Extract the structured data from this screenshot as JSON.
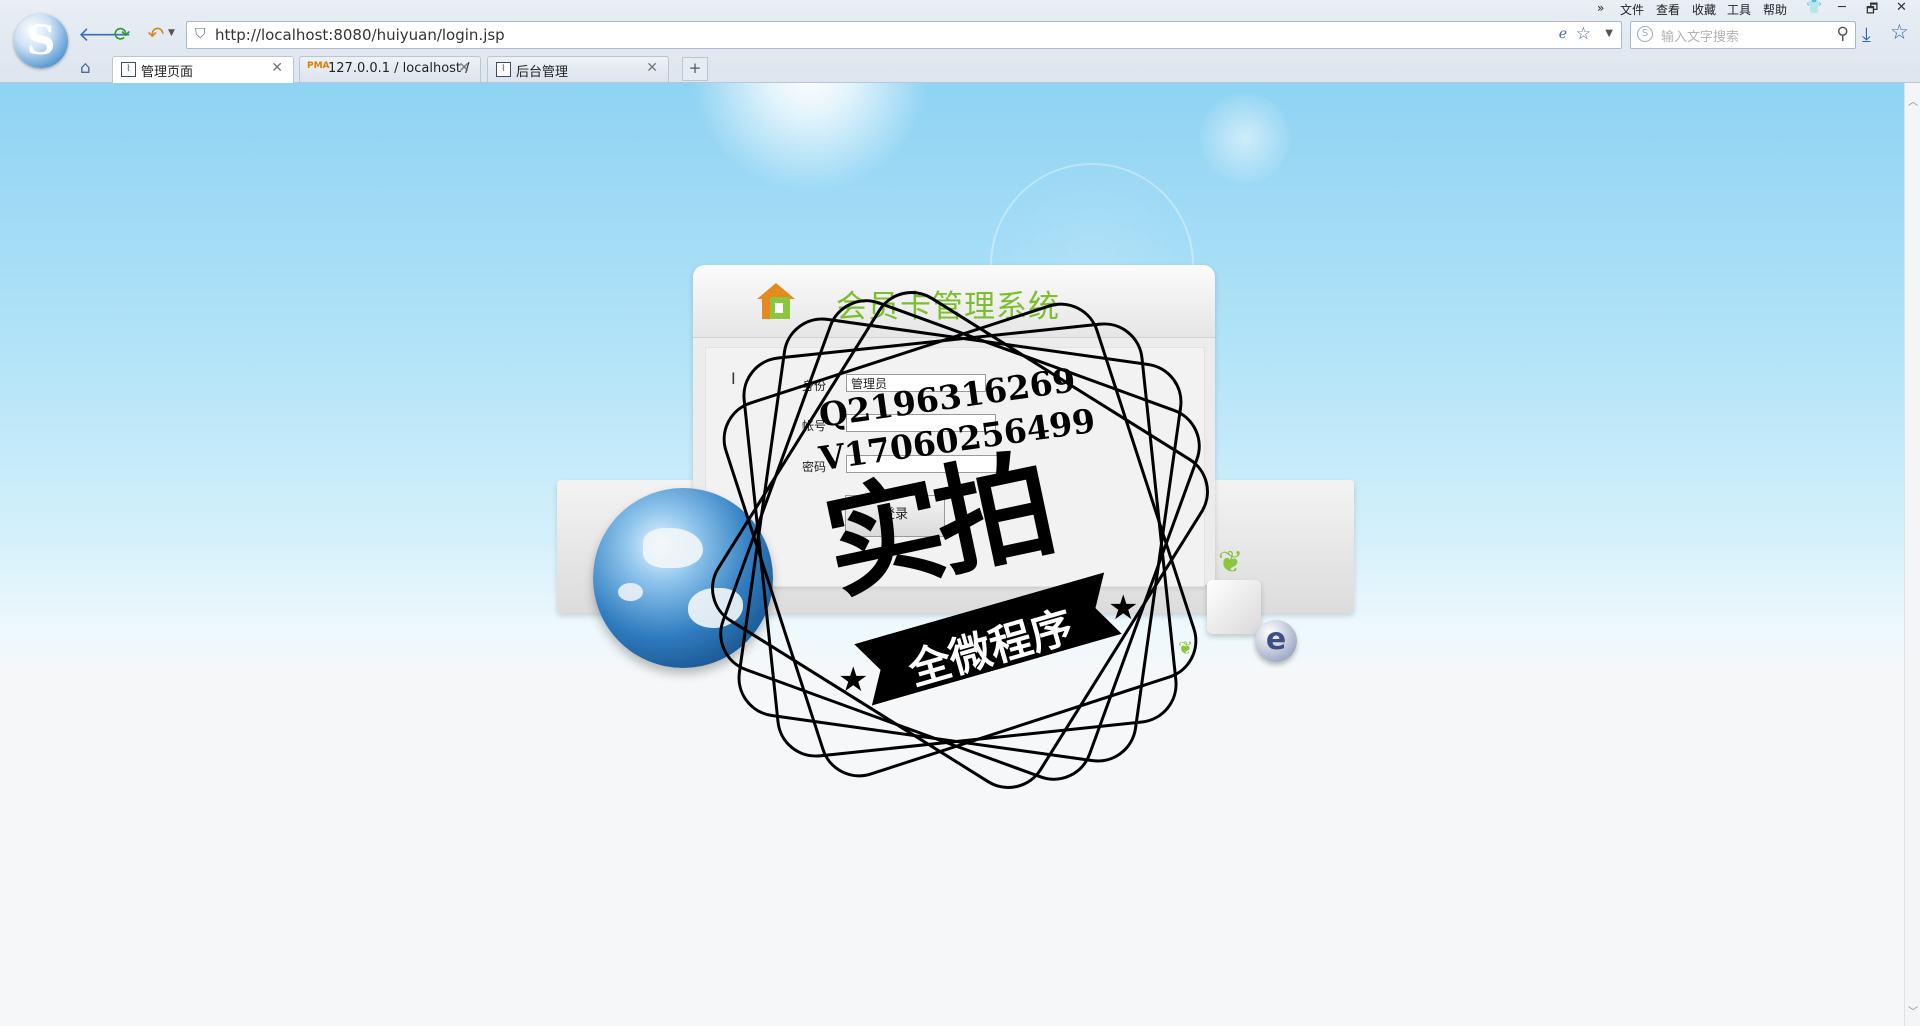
{
  "browser": {
    "logo_letter": "S",
    "url": "http://localhost:8080/huiyuan/login.jsp",
    "search_placeholder": "输入文字搜索",
    "menu": [
      "»",
      "文件",
      "查看",
      "收藏",
      "工具",
      "帮助"
    ],
    "window_controls": [
      "👕",
      "─",
      "🗗",
      "✕"
    ],
    "tabs": [
      {
        "label": "管理页面",
        "active": true
      },
      {
        "label": "127.0.0.1 / localhost /",
        "active": false,
        "icon_text": "PMA"
      },
      {
        "label": "后台管理",
        "active": false
      }
    ],
    "new_tab": "+"
  },
  "login": {
    "title": "会员卡管理系统",
    "identity_label": "身份",
    "identity_value": "管理员",
    "account_label": "帐号",
    "password_label": "密码",
    "login_button": "登录"
  },
  "watermark": {
    "id_line1": "Q2196316269",
    "id_line2": "V17060256499",
    "big_text": "实拍",
    "ribbon_text": "全微程序"
  },
  "colors": {
    "title_green": "#7cbf2e",
    "sky_blue": "#8fd3f3",
    "link_blue": "#2f67b0"
  }
}
